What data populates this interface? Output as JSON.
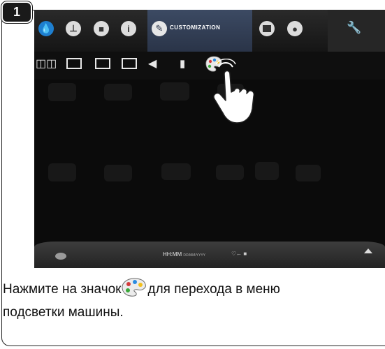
{
  "step_number": "1",
  "topbar": {
    "customization_label": "CUSTOMIZATION",
    "info_icon_glyph": "i"
  },
  "statusbar": {
    "time": "HH:MM",
    "date": "DD/MM/YYYY"
  },
  "caption": {
    "before_icon": "Нажмите на значок",
    "after_icon": "для перехода в меню",
    "line2": "подсветки машины."
  },
  "colors": {
    "accent_tab": "#3c4a63",
    "screen_bg": "#0b0b0b"
  },
  "icons": [
    "water-drop-icon",
    "thermometer-icon",
    "cup-icon",
    "info-icon",
    "customization-icon",
    "menu-icon",
    "user-icon",
    "wrench-icon",
    "book-icon",
    "image-icon",
    "speaker-icon",
    "palette-icon",
    "pointing-hand-icon"
  ]
}
